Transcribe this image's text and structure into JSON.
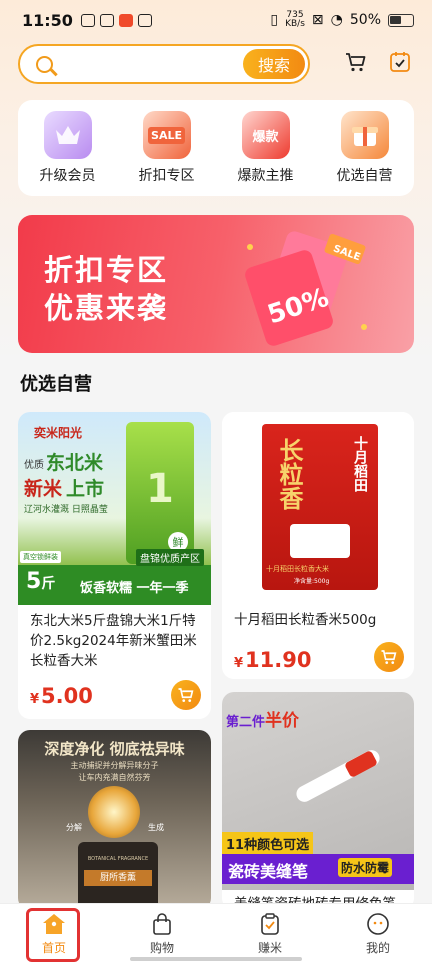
{
  "status": {
    "time": "11:50",
    "speed_value": "735",
    "speed_unit": "KB/s",
    "battery": "50%"
  },
  "search": {
    "placeholder": "",
    "button_label": "搜索"
  },
  "quick_menu": [
    {
      "label": "升级会员",
      "icon": "crown-icon",
      "color": "#b98cf0"
    },
    {
      "label": "折扣专区",
      "icon": "sale-icon",
      "color": "#f0643c",
      "badge": "SALE"
    },
    {
      "label": "爆款主推",
      "icon": "hot-icon",
      "color": "#ee3b2f",
      "badge": "爆款"
    },
    {
      "label": "优选自营",
      "icon": "gift-icon",
      "color": "#f5883b"
    }
  ],
  "banner": {
    "line1": "折扣专区",
    "line2": "优惠来袭",
    "tag": "50%",
    "sale": "SALE"
  },
  "section_title": "优选自营",
  "products": [
    {
      "name": "东北大米5斤盘锦大米1斤特价2.5kg2024年新米蟹田米长粒香大米",
      "currency": "¥",
      "price": "5.00",
      "image": {
        "brand": "奕米阳光",
        "line1a": "优质",
        "line1b": "东北米",
        "line2a": "新米",
        "line2b": "上市",
        "sub": "辽河水灌溉 日照晶莹",
        "weight": "5",
        "weight_unit": "斤",
        "vacuum": "真空锁鲜装",
        "bag_text": "鲜",
        "area": "盘锦优质产区",
        "slogan": "饭香软糯 一年一季"
      }
    },
    {
      "name": "十月稻田长粒香米500g",
      "currency": "¥",
      "price": "11.90",
      "image": {
        "brand_big": "长粒香",
        "brand_top": "十月稻田",
        "sub": "十月稻田长粒香大米",
        "weight": "净含量:500g"
      }
    },
    {
      "name": "",
      "image": {
        "title": "深度净化 彻底祛异味",
        "sub1": "主动捕捉并分解异味分子",
        "sub2": "让车内充满自然芬芳",
        "left": "分解",
        "right": "生成",
        "jar": "厨所香薰",
        "jar_sub": "BOTANICAL FRAGRANCE"
      }
    },
    {
      "name": "美缝笔瓷砖地砖专用修色笔",
      "image": {
        "top": "第二件",
        "top_highlight": "半价",
        "colors": "11种颜色可选",
        "title": "瓷砖美缝笔",
        "tag": "防水防霉"
      }
    }
  ],
  "tabbar": [
    {
      "label": "首页",
      "icon": "home-icon",
      "active": true
    },
    {
      "label": "购物",
      "icon": "bag-icon",
      "active": false
    },
    {
      "label": "赚米",
      "icon": "task-icon",
      "active": false
    },
    {
      "label": "我的",
      "icon": "profile-icon",
      "active": false
    }
  ],
  "colors": {
    "accent": "#f28a12",
    "price": "#e0321f",
    "highlight_frame": "#e23232"
  }
}
